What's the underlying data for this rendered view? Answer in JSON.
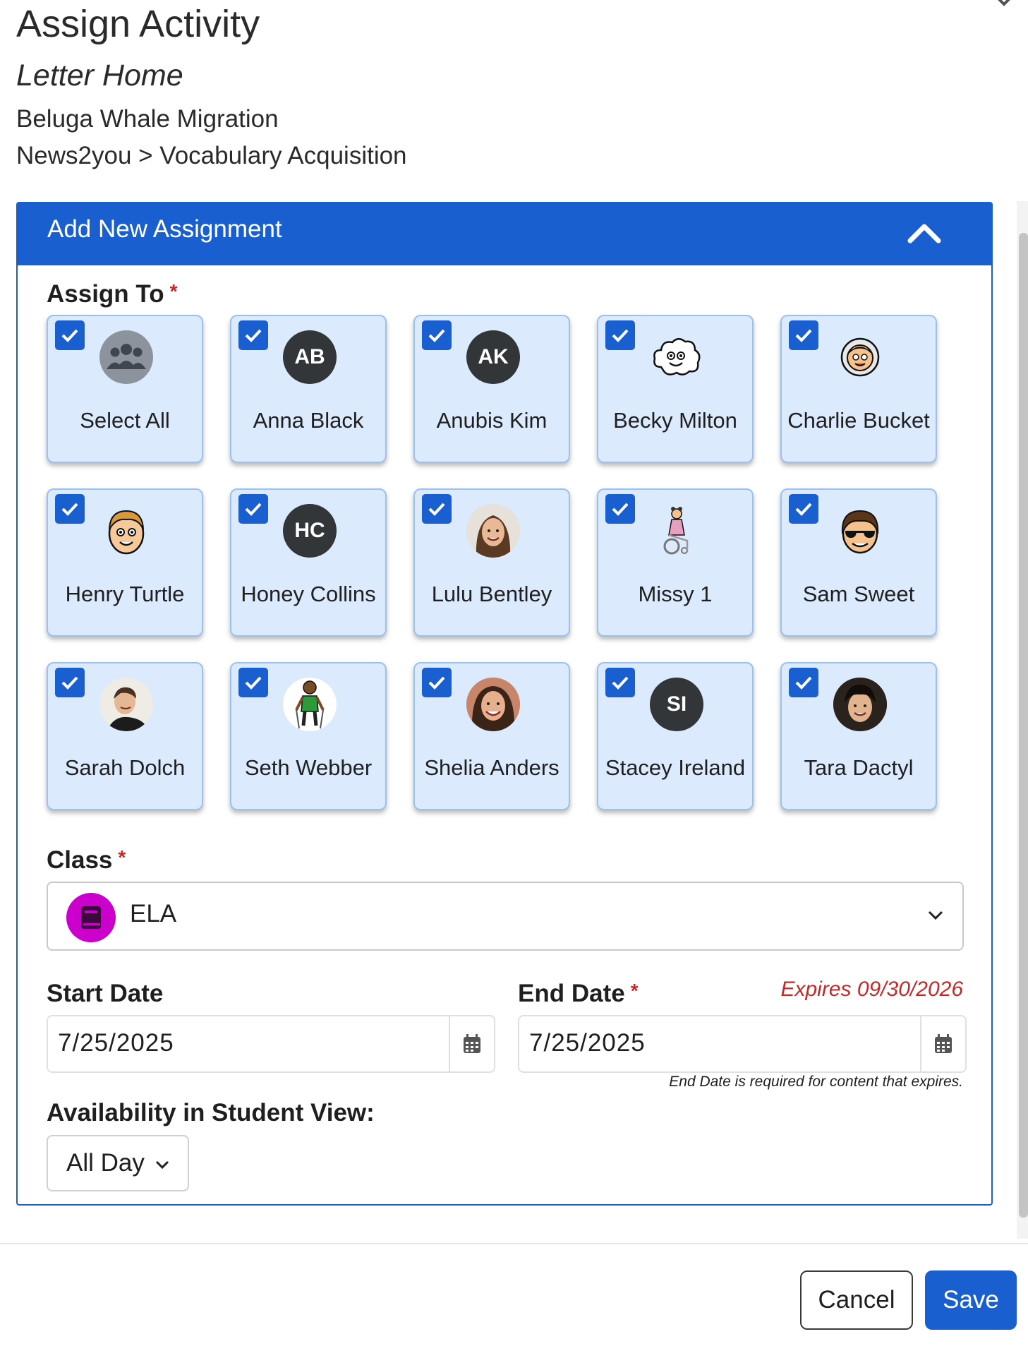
{
  "header": {
    "title": "Assign Activity",
    "activity_type": "Letter Home",
    "activity_name": "Beluga Whale Migration",
    "breadcrumb": "News2you > Vocabulary Acquisition"
  },
  "panel": {
    "title": "Add New Assignment",
    "assign_to_label": "Assign To",
    "required_marker": "*"
  },
  "students": [
    {
      "name": "Select All",
      "avatar": "group-icon",
      "checked": true
    },
    {
      "name": "Anna Black",
      "initials": "AB",
      "checked": true
    },
    {
      "name": "Anubis Kim",
      "initials": "AK",
      "checked": true
    },
    {
      "name": "Becky Milton",
      "avatar": "cloud-face-icon",
      "checked": true
    },
    {
      "name": "Charlie Bucket",
      "avatar": "astronaut-icon",
      "checked": true
    },
    {
      "name": "Henry Turtle",
      "avatar": "boy-face-icon",
      "checked": true
    },
    {
      "name": "Honey Collins",
      "initials": "HC",
      "checked": true
    },
    {
      "name": "Lulu Bentley",
      "avatar": "photo-girl-icon",
      "checked": true
    },
    {
      "name": "Missy 1",
      "avatar": "wheelchair-girl-icon",
      "checked": true
    },
    {
      "name": "Sam Sweet",
      "avatar": "sunglasses-face-icon",
      "checked": true
    },
    {
      "name": "Sarah Dolch",
      "avatar": "photo-person-icon",
      "checked": true
    },
    {
      "name": "Seth Webber",
      "avatar": "boy-figure-icon",
      "checked": true
    },
    {
      "name": "Shelia Anders",
      "avatar": "photo-girl-smile-icon",
      "checked": true
    },
    {
      "name": "Stacey Ireland",
      "initials": "SI",
      "checked": true
    },
    {
      "name": "Tara Dactyl",
      "avatar": "photo-girl-dark-icon",
      "checked": true
    }
  ],
  "class": {
    "label": "Class",
    "value": "ELA",
    "icon": "book-icon",
    "icon_color": "#cc00cc"
  },
  "start_date": {
    "label": "Start Date",
    "value": "7/25/2025"
  },
  "end_date": {
    "label": "End Date",
    "value": "7/25/2025",
    "expires": "Expires 09/30/2026",
    "note": "End Date is required for content that expires."
  },
  "availability": {
    "label": "Availability in Student View:",
    "value": "All Day"
  },
  "footer": {
    "cancel_label": "Cancel",
    "save_label": "Save"
  },
  "colors": {
    "primary": "#1a5fd0",
    "tile_bg": "#dbeafd",
    "required": "#c62828"
  }
}
